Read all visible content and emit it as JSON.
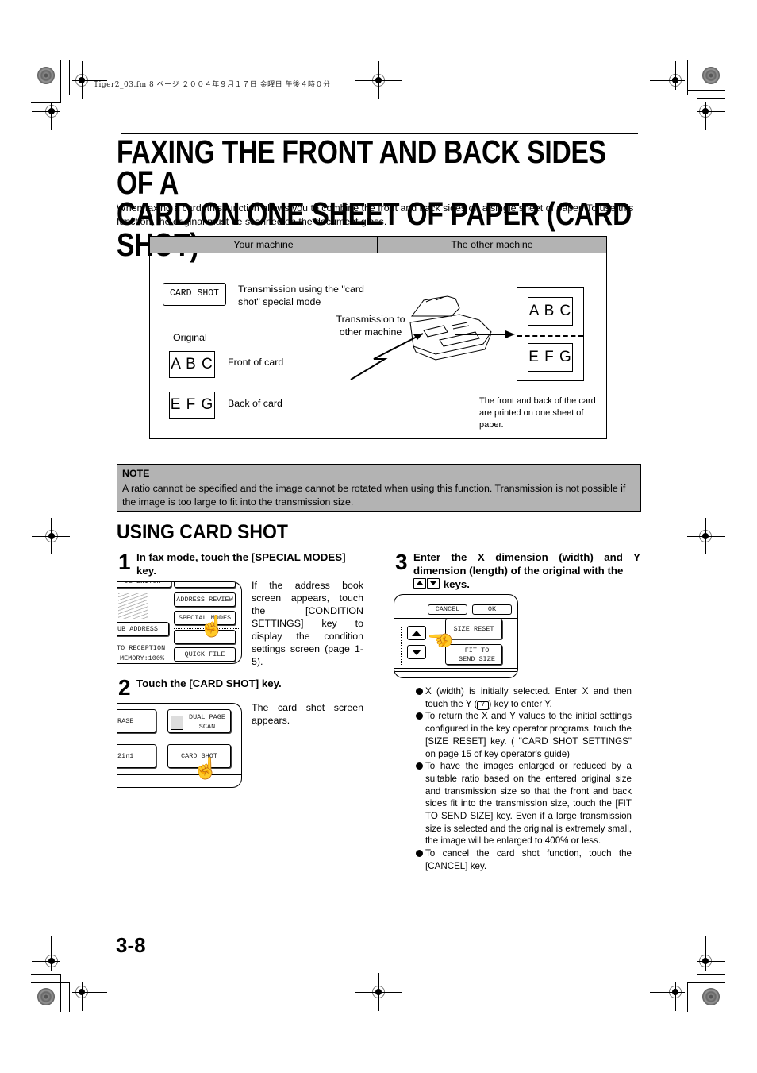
{
  "meta_line": "Tiger2_03.fm  8 ページ  ２００４年９月１７日  金曜日  午後４時０分",
  "title": {
    "line1": "FAXING THE FRONT AND BACK SIDES OF A",
    "line2": "CARD ON ONE SHEET OF PAPER (CARD SHOT)"
  },
  "intro": "When faxing a card, this function allows you to combine the front and back sides on a single sheet of paper. To use this function, the original must be scanned on the document glass.",
  "diagram": {
    "headers": [
      "Your machine",
      "The other machine"
    ],
    "card_shot_key": "CARD SHOT",
    "card_shot_desc": "Transmission using the \"card shot\" special mode",
    "original_label": "Original",
    "front_card": "A B C",
    "front_label": "Front of card",
    "back_card": "E F G",
    "back_label": "Back of card",
    "transmission_label": "Transmission to other machine",
    "output_front": "A B C",
    "output_back": "E F G",
    "output_desc": "The front and back of the card are printed on one sheet of paper."
  },
  "note": {
    "title": "NOTE",
    "text": "A ratio cannot be specified and the image cannot be rotated when using this function. Transmission is not possible if the image is too large to fit into the transmission size."
  },
  "section_title": "USING CARD SHOT",
  "steps": [
    {
      "number": "1",
      "heading": "In fax mode, touch the [SPECIAL MODES] key.",
      "text": "If the address book screen appears, touch the [CONDITION SETTINGS] key to display the condition settings screen (page 1-5).",
      "screen": {
        "top_partial": "DE SWITCH",
        "address_review": "ADDRESS REVIEW",
        "special_modes": "SPECIAL MODES",
        "sub_address": "UB ADDRESS",
        "to_reception": "TO RECEPTION",
        "memory": "MEMORY:100%",
        "quick_file": "QUICK FILE"
      }
    },
    {
      "number": "2",
      "heading": "Touch the [CARD SHOT] key.",
      "text": "The card shot screen appears.",
      "screen": {
        "erase": "RASE",
        "dual_page_scan": "DUAL PAGE SCAN",
        "two_in_one": "2in1",
        "card_shot": "CARD SHOT"
      }
    },
    {
      "number": "3",
      "heading_part1": "Enter the X dimension (width) and Y dimension (length) of the original with the",
      "heading_part2": "keys.",
      "screen": {
        "cancel": "CANCEL",
        "ok": "OK",
        "size_reset": "SIZE RESET",
        "fit_to_send_size": "FIT TO SEND SIZE"
      },
      "bullets": [
        {
          "pre": "X (width) is initially selected. Enter X and then touch the Y (",
          "key": "Y",
          "post": ") key to enter Y."
        },
        {
          "pre": "To return the X and Y values to the initial settings configured in the key operator programs, touch the [SIZE RESET] key. ( \"CARD SHOT SETTINGS\" on page 15 of key operator's guide)"
        },
        {
          "pre": "To have the images enlarged or reduced by a suitable ratio based on the entered original size and transmission size so that the front and back sides fit into the transmission size, touch the [FIT TO SEND SIZE] key. Even if a large transmission size is selected and the original is extremely small, the image will be enlarged to 400% or less."
        },
        {
          "pre": "To cancel the card shot function, touch the [CANCEL] key."
        }
      ]
    }
  ],
  "page_number": "3-8"
}
